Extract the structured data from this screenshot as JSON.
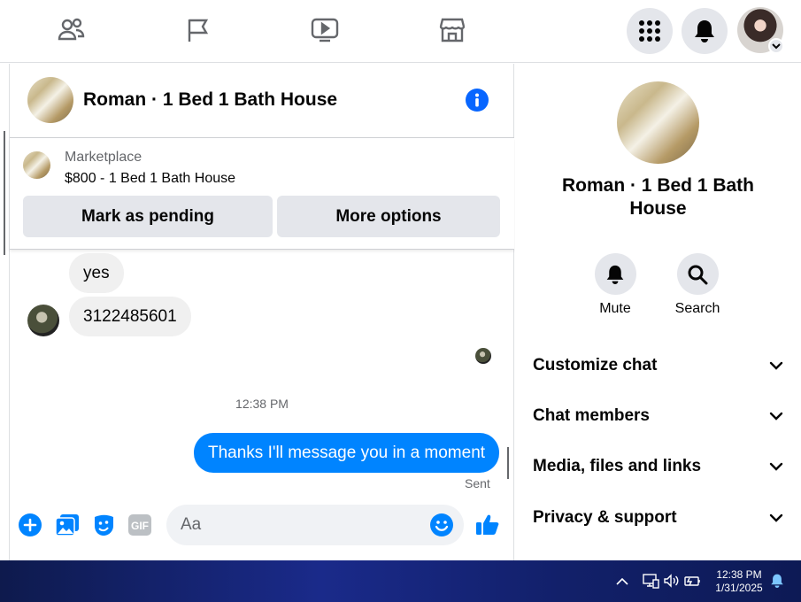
{
  "chat": {
    "title": "Roman · 1 Bed 1 Bath House",
    "marketplace_label": "Marketplace",
    "listing": "$800 - 1 Bed 1 Bath House",
    "mark_pending": "Mark as pending",
    "more_options": "More options",
    "messages": [
      {
        "text": "yes"
      },
      {
        "text": "3122485601"
      }
    ],
    "timestamp": "12:38 PM",
    "outgoing": "Thanks I'll message you in a moment",
    "status": "Sent",
    "composer_placeholder": "Aa",
    "gif_label": "GIF"
  },
  "details": {
    "title": "Roman · 1 Bed 1 Bath House",
    "actions": [
      {
        "label": "Mute",
        "icon": "bell-icon"
      },
      {
        "label": "Search",
        "icon": "search-icon"
      }
    ],
    "sections": [
      {
        "label": "Customize chat"
      },
      {
        "label": "Chat members"
      },
      {
        "label": "Media, files and links"
      },
      {
        "label": "Privacy & support"
      }
    ]
  },
  "taskbar": {
    "time": "12:38 PM",
    "date": "1/31/2025"
  },
  "colors": {
    "messenger_blue": "#0084ff",
    "fb_blue": "#0866ff",
    "bubble_gray": "#f0f0f0",
    "button_gray": "#e4e6eb"
  }
}
